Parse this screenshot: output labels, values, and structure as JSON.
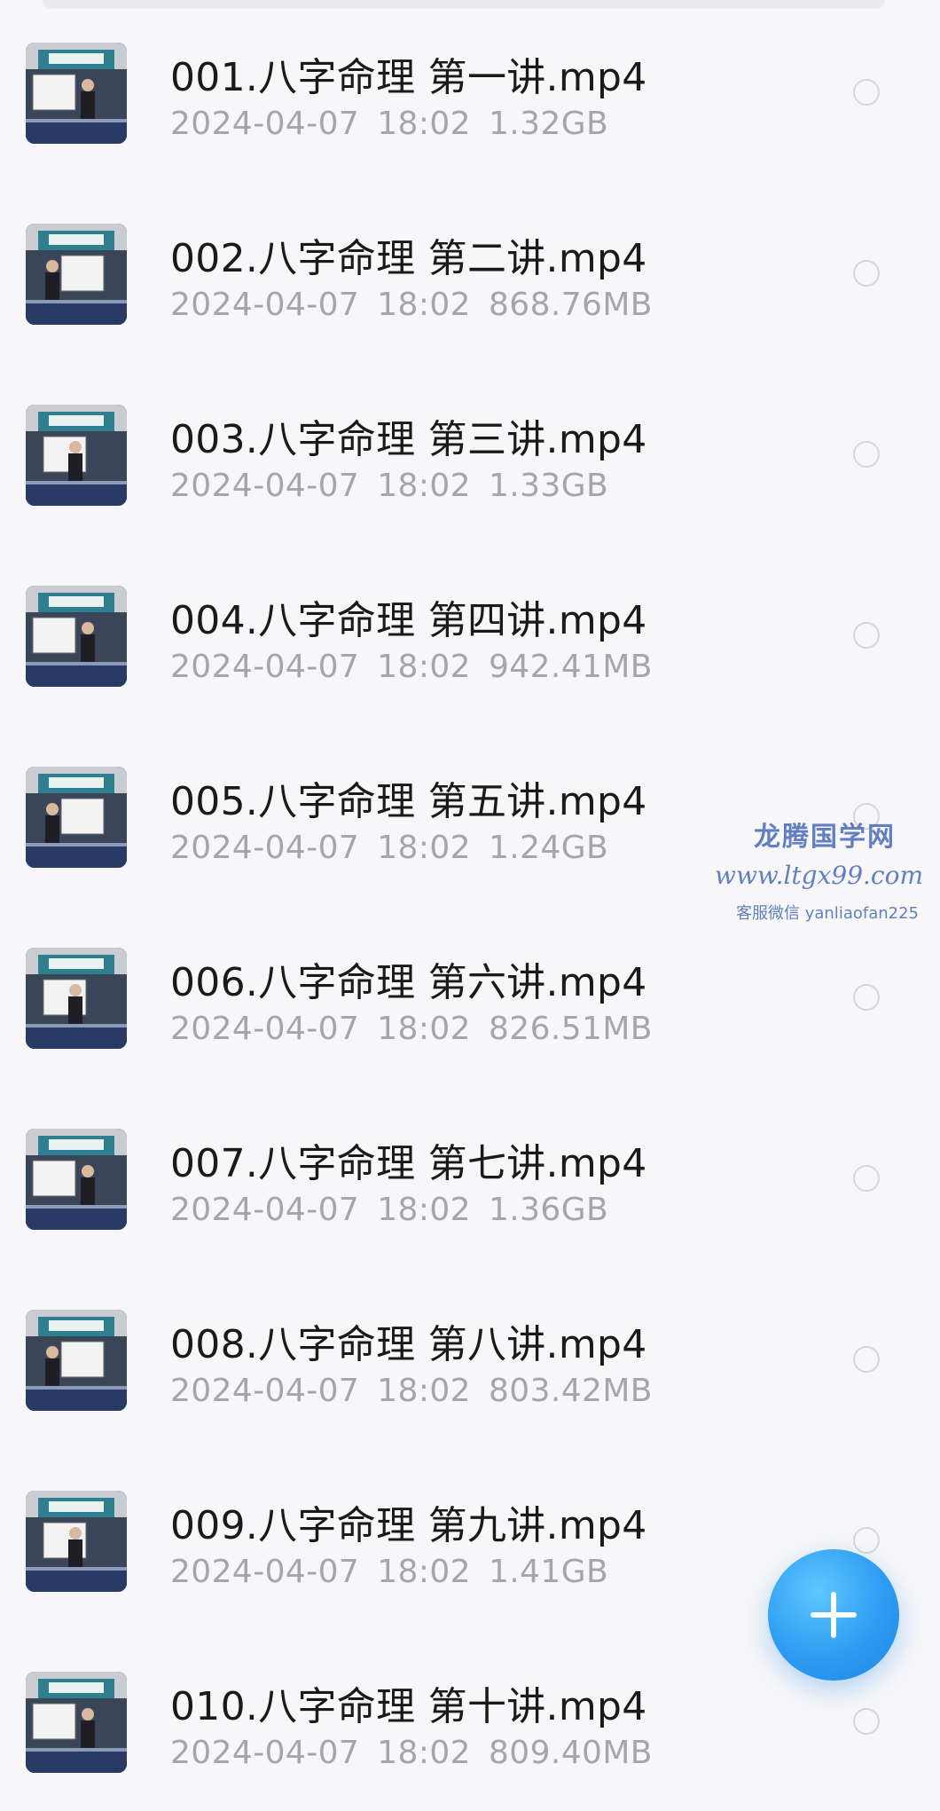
{
  "files": [
    {
      "name": "001.八字命理 第一讲.mp4",
      "date": "2024-04-07",
      "time": "18:02",
      "size": "1.32GB"
    },
    {
      "name": "002.八字命理 第二讲.mp4",
      "date": "2024-04-07",
      "time": "18:02",
      "size": "868.76MB"
    },
    {
      "name": "003.八字命理 第三讲.mp4",
      "date": "2024-04-07",
      "time": "18:02",
      "size": "1.33GB"
    },
    {
      "name": "004.八字命理 第四讲.mp4",
      "date": "2024-04-07",
      "time": "18:02",
      "size": "942.41MB"
    },
    {
      "name": "005.八字命理 第五讲.mp4",
      "date": "2024-04-07",
      "time": "18:02",
      "size": "1.24GB"
    },
    {
      "name": "006.八字命理 第六讲.mp4",
      "date": "2024-04-07",
      "time": "18:02",
      "size": "826.51MB"
    },
    {
      "name": "007.八字命理 第七讲.mp4",
      "date": "2024-04-07",
      "time": "18:02",
      "size": "1.36GB"
    },
    {
      "name": "008.八字命理 第八讲.mp4",
      "date": "2024-04-07",
      "time": "18:02",
      "size": "803.42MB"
    },
    {
      "name": "009.八字命理 第九讲.mp4",
      "date": "2024-04-07",
      "time": "18:02",
      "size": "1.41GB"
    },
    {
      "name": "010.八字命理 第十讲.mp4",
      "date": "2024-04-07",
      "time": "18:02",
      "size": "809.40MB"
    }
  ],
  "watermark": {
    "title": "龙腾国学网",
    "url": "www.ltgx99.com",
    "contact": "客服微信 yanliaofan225"
  },
  "fab": {
    "icon": "plus-icon"
  },
  "colors": {
    "background": "#f7f7f9",
    "title_text": "#1a1a1a",
    "meta_text": "#a4a6ab",
    "accent": "#2e9cf2",
    "watermark": "#4a6bb8"
  }
}
